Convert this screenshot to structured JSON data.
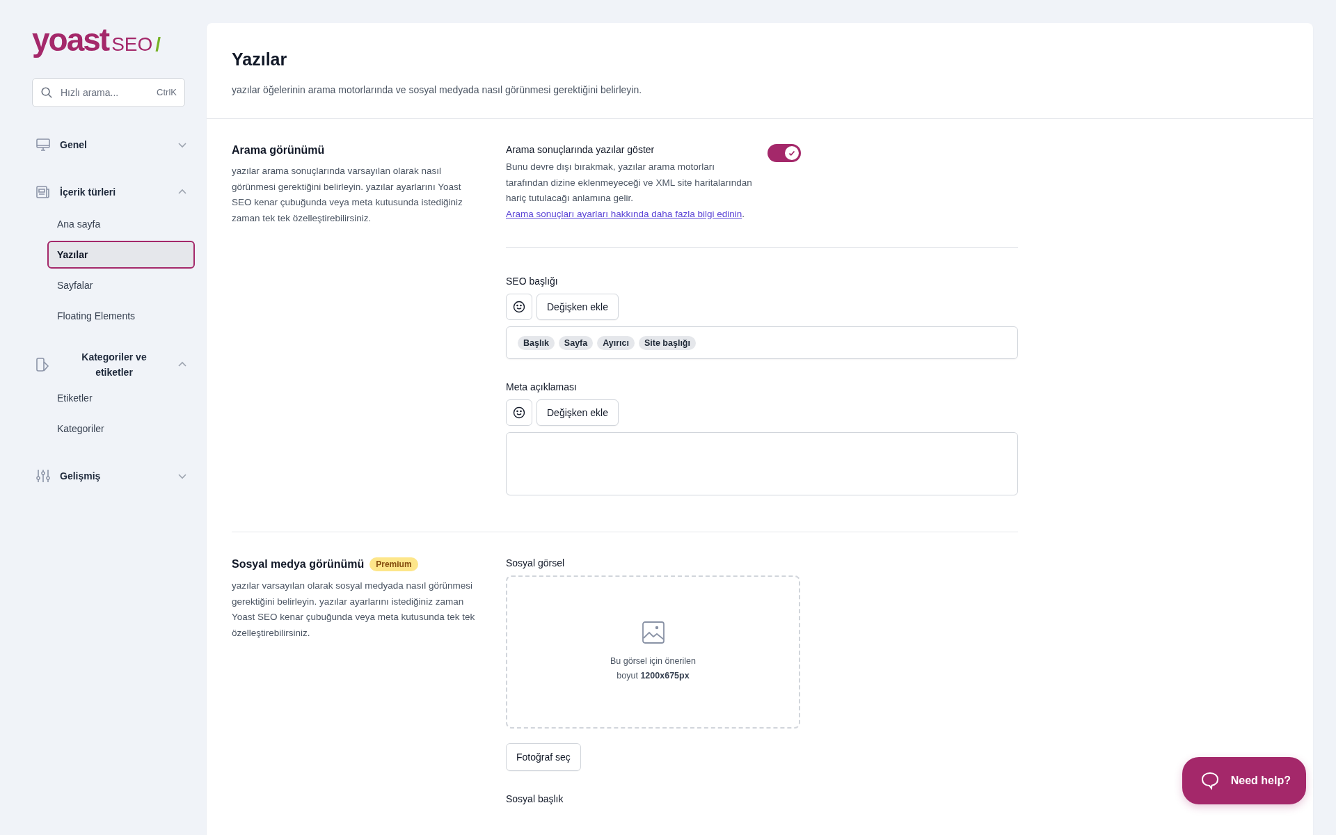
{
  "logo": {
    "name": "yoast",
    "product": "SEO",
    "slash": "/"
  },
  "search": {
    "placeholder": "Hızlı arama...",
    "shortcut": "CtrlK"
  },
  "nav": [
    {
      "label": "Genel",
      "expanded": false
    },
    {
      "label": "İçerik türleri",
      "expanded": true,
      "children": [
        {
          "label": "Ana sayfa",
          "selected": false
        },
        {
          "label": "Yazılar",
          "selected": true
        },
        {
          "label": "Sayfalar",
          "selected": false
        },
        {
          "label": "Floating Elements",
          "selected": false
        }
      ]
    },
    {
      "label": "Kategoriler ve etiketler",
      "expanded": true,
      "children": [
        {
          "label": "Etiketler",
          "selected": false
        },
        {
          "label": "Kategoriler",
          "selected": false
        }
      ]
    },
    {
      "label": "Gelişmiş",
      "expanded": false
    }
  ],
  "page": {
    "title": "Yazılar",
    "description": "yazılar öğelerinin arama motorlarında ve sosyal medyada nasıl görünmesi gerektiğini belirleyin."
  },
  "sections": [
    {
      "title": "Arama görünümü",
      "description": "yazılar arama sonuçlarında varsayılan olarak nasıl görünmesi gerektiğini belirleyin. yazılar ayarlarını Yoast SEO kenar çubuğunda veya meta kutusunda istediğiniz zaman tek tek özelleştirebilirsiniz.",
      "fields": [
        {
          "kind": "toggle",
          "label": "Arama sonuçlarında yazılar göster",
          "on": true,
          "description": "Bunu devre dışı bırakmak, yazılar arama motorları tarafından dizine eklenmeyeceği ve XML site haritalarından hariç tutulacağı anlamına gelir.",
          "link": "Arama sonuçları ayarları hakkında daha fazla bilgi edinin",
          "after": "."
        },
        {
          "kind": "divider"
        },
        {
          "kind": "template",
          "label": "SEO başlığı",
          "button": "Değişken ekle",
          "tags": [
            "Başlık",
            "Sayfa",
            "Ayırıcı",
            "Site başlığı"
          ]
        },
        {
          "kind": "textarea",
          "label": "Meta açıklaması",
          "button": "Değişken ekle"
        }
      ]
    },
    {
      "title": "Sosyal medya görünümü",
      "badge": "Premium",
      "description": "yazılar varsayılan olarak sosyal medyada nasıl görünmesi gerektiğini belirleyin. yazılar ayarlarını istediğiniz zaman Yoast SEO kenar çubuğunda veya meta kutusunda tek tek özelleştirebilirsiniz.",
      "fields": [
        {
          "kind": "image",
          "label": "Sosyal görsel",
          "hint": "Bu görsel için önerilen boyut **1200x675px**",
          "button": "Fotoğraf seç"
        },
        {
          "kind": "heading",
          "label": "Sosyal başlık"
        }
      ]
    }
  ],
  "help": {
    "label": "Need help?"
  }
}
